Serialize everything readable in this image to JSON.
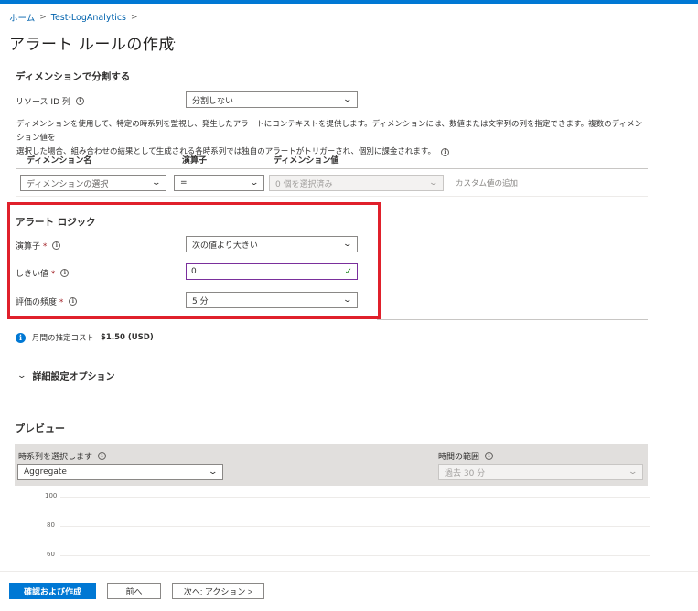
{
  "breadcrumb": {
    "home": "ホーム",
    "resource": "Test-LogAnalytics"
  },
  "page": {
    "title": "アラート ルールの作成",
    "more": "..."
  },
  "split": {
    "heading": "ディメンションで分割する",
    "resource_id_label": "リソース ID 列",
    "resource_id_value": "分割しない",
    "description_line1": "ディメンションを使用して、特定の時系列を監視し、発生したアラートにコンテキストを提供します。ディメンションには、数値または文字列の列を指定できます。複数のディメンション値を",
    "description_line2": "選択した場合、組み合わせの結果として生成される各時系列では独自のアラートがトリガーされ、個別に課金されます。",
    "col_dim_name": "ディメンション名",
    "col_operator": "演算子",
    "col_dim_value": "ディメンション値",
    "dim_name_placeholder": "ディメンションの選択",
    "operator_value": "=",
    "dim_value_placeholder": "0 個を選択済み",
    "custom_value": "カスタム値の追加"
  },
  "logic": {
    "heading": "アラート ロジック",
    "operator_label": "演算子",
    "operator_value": "次の値より大きい",
    "threshold_label": "しきい値",
    "threshold_value": "0",
    "frequency_label": "評価の頻度",
    "frequency_value": "5 分",
    "required_mark": "*"
  },
  "cost": {
    "label": "月間の推定コスト",
    "value": "$1.50 (USD)"
  },
  "advanced": {
    "label": "詳細設定オプション"
  },
  "preview": {
    "heading": "プレビュー",
    "timeseries_label": "時系列を選択します",
    "timeseries_value": "Aggregate",
    "timerange_label": "時間の範囲",
    "timerange_value": "過去 30 分",
    "y_ticks": [
      "100",
      "80",
      "60"
    ]
  },
  "footer": {
    "review_create": "確認および作成",
    "previous": "前へ",
    "next": "次へ: アクション >"
  },
  "colors": {
    "accent": "#0078d4",
    "highlight_border": "#e0202b",
    "required": "#a4262c"
  }
}
